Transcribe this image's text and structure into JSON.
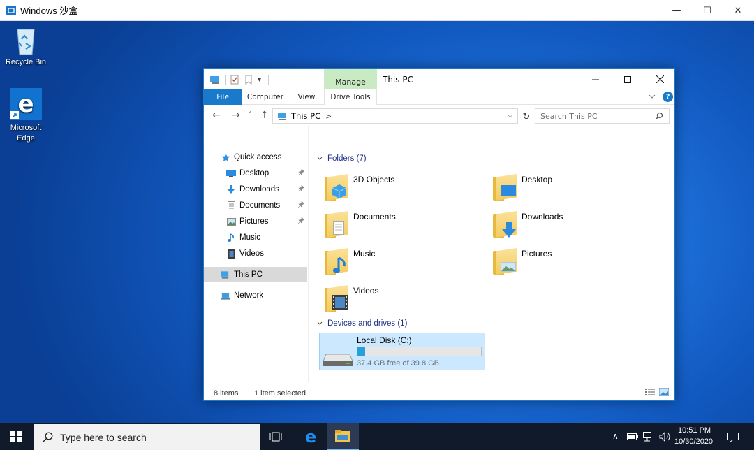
{
  "host": {
    "title": "Windows 沙盒",
    "minimize": "—",
    "maximize": "☐",
    "close": "✕"
  },
  "desktop": {
    "icons": [
      {
        "label": "Recycle Bin"
      },
      {
        "label": "Microsoft Edge"
      }
    ]
  },
  "explorer": {
    "title": "This PC",
    "manage_tab": "Manage",
    "qat_dropdown": "▾",
    "tabs": {
      "file": "File",
      "computer": "Computer",
      "view": "View",
      "drive_tools": "Drive Tools"
    },
    "help": "?",
    "address": {
      "back": "←",
      "forward": "→",
      "recent": "˅",
      "up": "↑",
      "path": "This PC",
      "sep": ">",
      "dropdown": "⌵",
      "refresh": "↻"
    },
    "search": {
      "placeholder": "Search This PC"
    },
    "nav": {
      "quick_access": "Quick access",
      "desktop": "Desktop",
      "downloads": "Downloads",
      "documents": "Documents",
      "pictures": "Pictures",
      "music": "Music",
      "videos": "Videos",
      "this_pc": "This PC",
      "network": "Network"
    },
    "folders_header": "Folders (7)",
    "folders": [
      "3D Objects",
      "Desktop",
      "Documents",
      "Downloads",
      "Music",
      "Pictures",
      "Videos"
    ],
    "devices_header": "Devices and drives (1)",
    "drive": {
      "name": "Local Disk (C:)",
      "free_text": "37.4 GB free of 39.8 GB",
      "used_fraction": 0.06
    },
    "status": {
      "items": "8 items",
      "selected": "1 item selected"
    }
  },
  "taskbar": {
    "search_placeholder": "Type here to search",
    "time": "10:51 PM",
    "date": "10/30/2020",
    "tray_chevron": "∧"
  },
  "colors": {
    "accent": "#1979ca",
    "selection": "#cce8ff",
    "manage": "#c9eac2",
    "taskbar": "#101a2b"
  }
}
